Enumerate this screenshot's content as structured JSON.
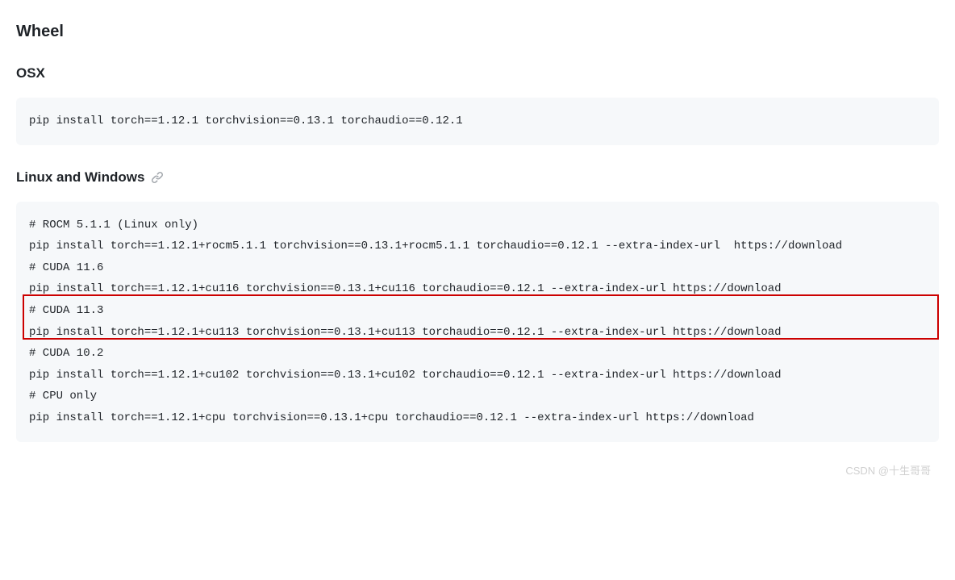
{
  "headings": {
    "wheel": "Wheel",
    "osx": "OSX",
    "linux_windows": "Linux and Windows"
  },
  "osx_code": "pip install torch==1.12.1 torchvision==0.13.1 torchaudio==0.12.1",
  "linux_windows_code": [
    "# ROCM 5.1.1 (Linux only)",
    "pip install torch==1.12.1+rocm5.1.1 torchvision==0.13.1+rocm5.1.1 torchaudio==0.12.1 --extra-index-url  https://download",
    "# CUDA 11.6",
    "pip install torch==1.12.1+cu116 torchvision==0.13.1+cu116 torchaudio==0.12.1 --extra-index-url https://download",
    "# CUDA 11.3",
    "pip install torch==1.12.1+cu113 torchvision==0.13.1+cu113 torchaudio==0.12.1 --extra-index-url https://download",
    "# CUDA 10.2",
    "pip install torch==1.12.1+cu102 torchvision==0.13.1+cu102 torchaudio==0.12.1 --extra-index-url https://download",
    "# CPU only",
    "pip install torch==1.12.1+cpu torchvision==0.13.1+cpu torchaudio==0.12.1 --extra-index-url https://download"
  ],
  "watermark": "CSDN @十生哥哥"
}
